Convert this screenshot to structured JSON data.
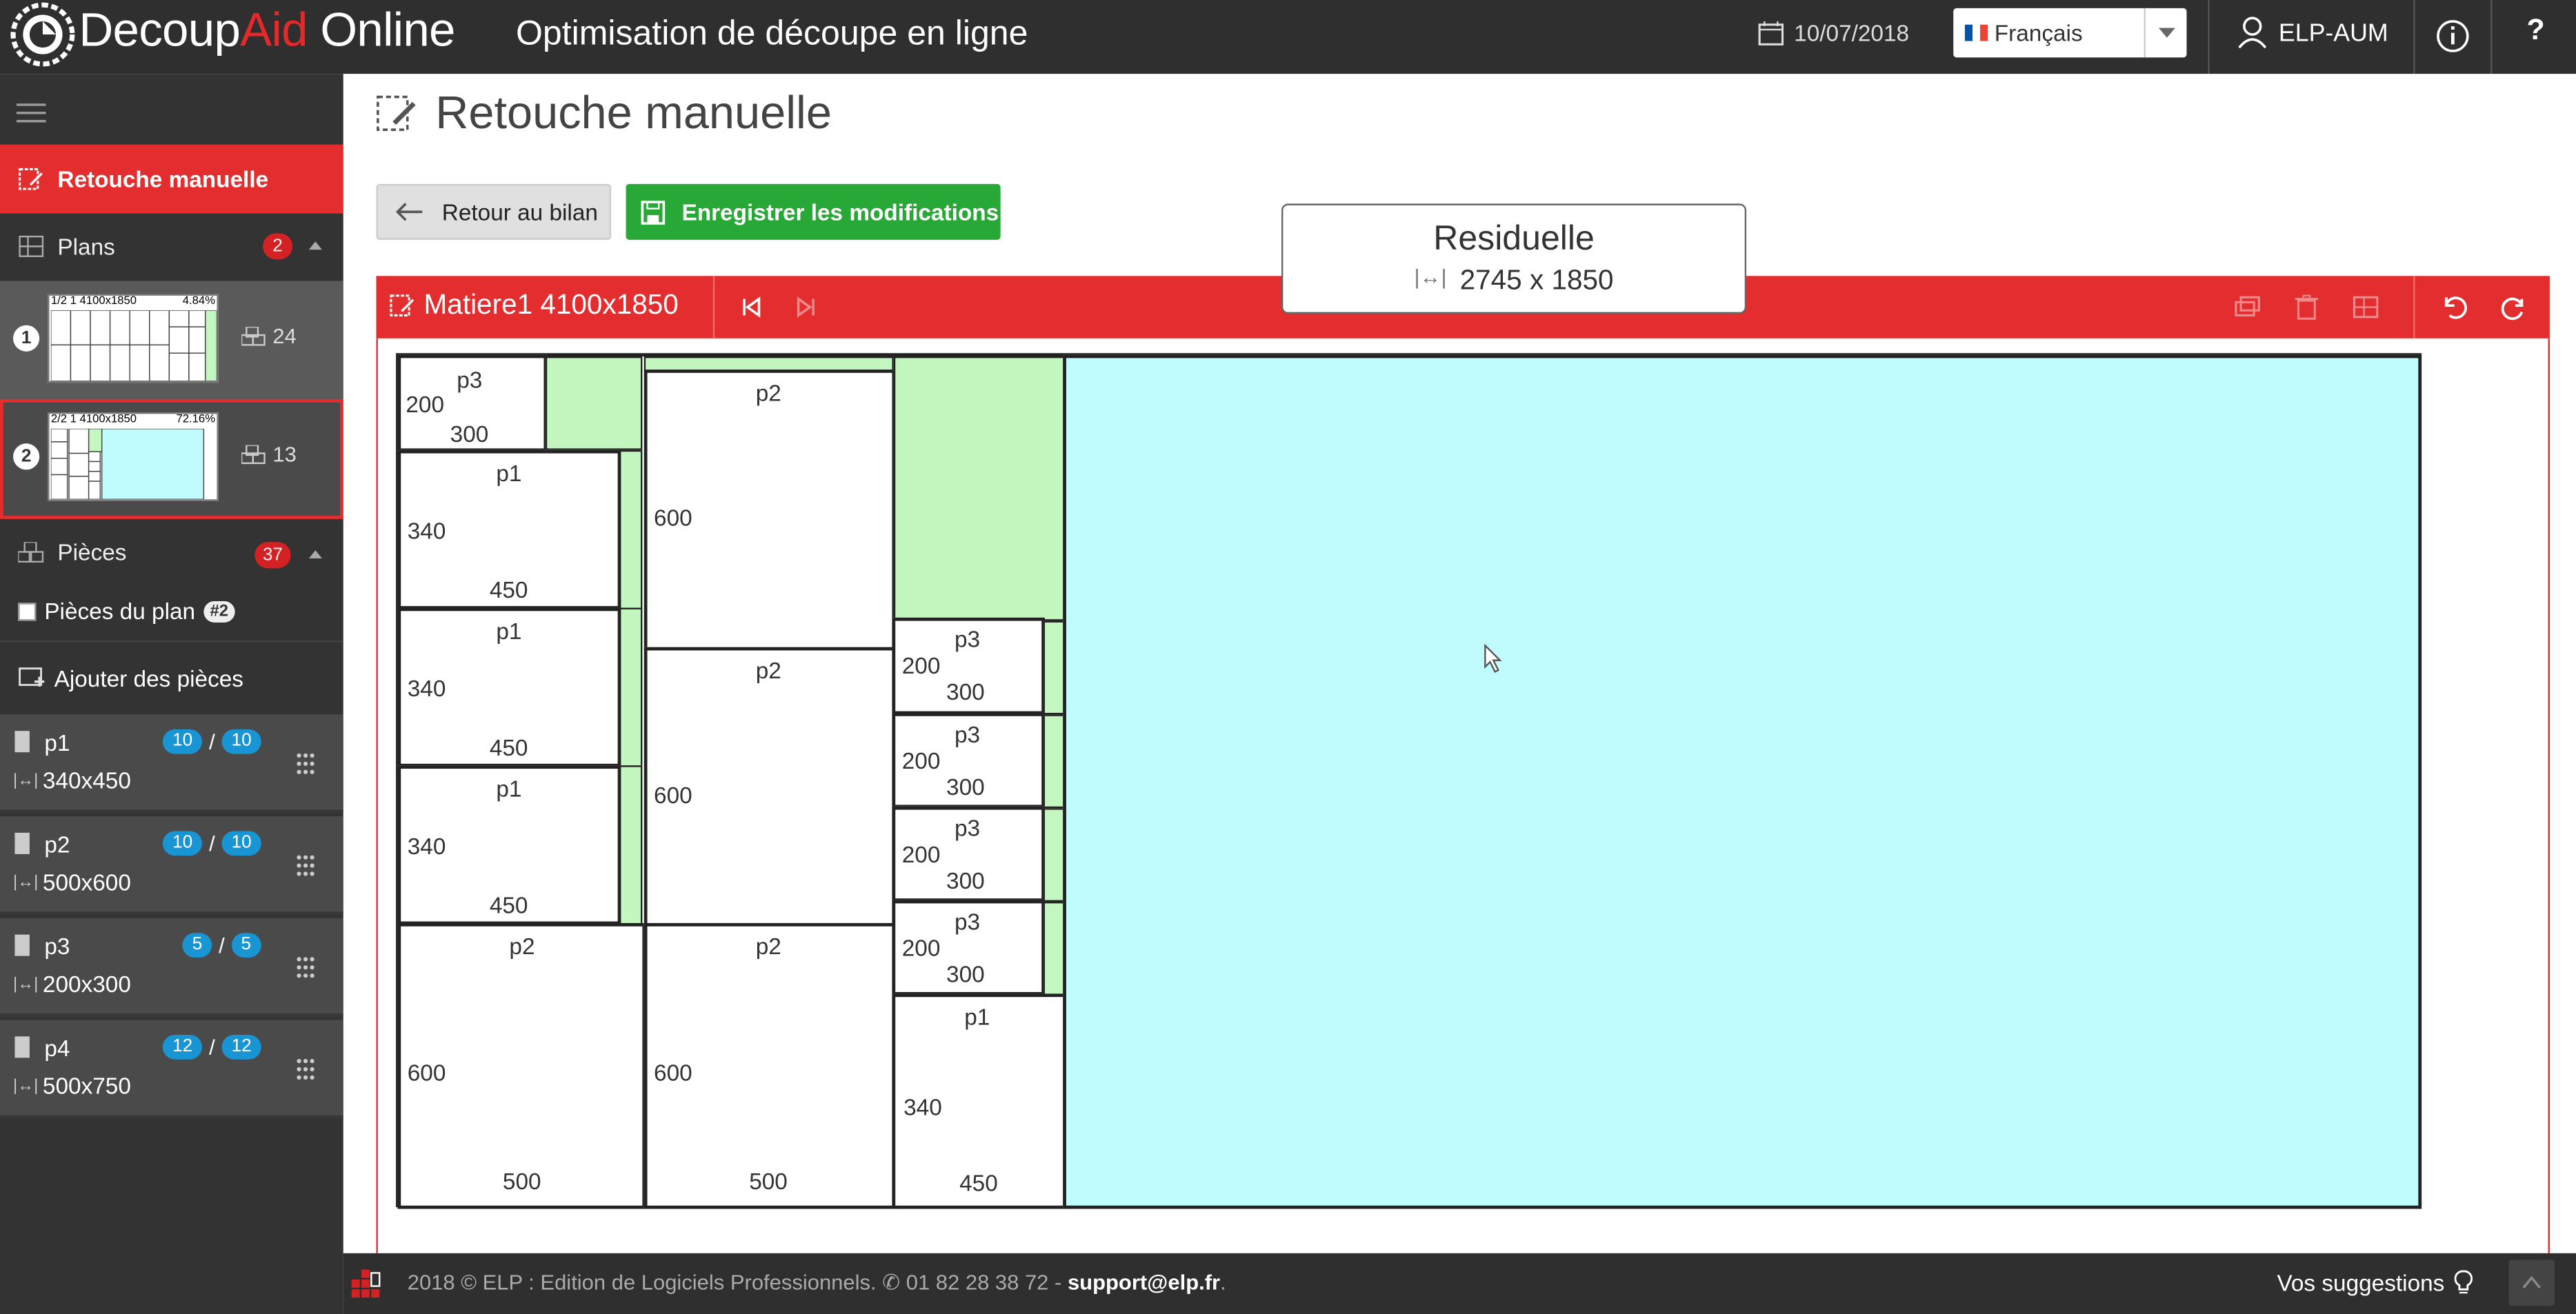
{
  "header": {
    "brand_part1": "Decoup",
    "brand_part2": "Aid",
    "brand_part3": " Online",
    "app_title": "Optimisation de découpe en ligne",
    "date": "10/07/2018",
    "language": "Français",
    "user": "ELP-AUM",
    "help": "?"
  },
  "sidebar": {
    "active_item": "Retouche manuelle",
    "plans_label": "Plans",
    "plans_count": "2",
    "plans": [
      {
        "num": "1",
        "thumb_label": "1/2  1 4100x1850",
        "thumb_pct": "4.84%",
        "count": "24"
      },
      {
        "num": "2",
        "thumb_label": "2/2  1 4100x1850",
        "thumb_pct": "72.16%",
        "count": "13"
      }
    ],
    "pieces_label": "Pièces",
    "pieces_count": "37",
    "plan_pieces_label": "Pièces du plan",
    "plan_pieces_badge": "#2",
    "add_pieces_label": "Ajouter des pièces",
    "pieces": [
      {
        "name": "p1",
        "placed": "10",
        "total": "10",
        "dims": "340x450"
      },
      {
        "name": "p2",
        "placed": "10",
        "total": "10",
        "dims": "500x600"
      },
      {
        "name": "p3",
        "placed": "5",
        "total": "5",
        "dims": "200x300"
      },
      {
        "name": "p4",
        "placed": "12",
        "total": "12",
        "dims": "500x750"
      }
    ],
    "slash": "/"
  },
  "main": {
    "page_title": "Retouche manuelle",
    "back_button": "Retour au bilan",
    "save_button": "Enregistrer les modifications",
    "material_title": "Matiere1 4100x1850",
    "residual_popup": {
      "title": "Residuelle",
      "dims": "2745 x 1850"
    }
  },
  "cutting_plan": {
    "pieces": [
      {
        "name": "p3",
        "w": "300",
        "h": "200"
      },
      {
        "name": "p1",
        "w": "450",
        "h": "340"
      },
      {
        "name": "p1",
        "w": "450",
        "h": "340"
      },
      {
        "name": "p1",
        "w": "450",
        "h": "340"
      },
      {
        "name": "p2",
        "w": "500",
        "h": "600"
      },
      {
        "name": "p2",
        "w": "",
        "h": "600"
      },
      {
        "name": "p2",
        "w": "",
        "h": "600"
      },
      {
        "name": "p2",
        "w": "500",
        "h": "600"
      },
      {
        "name": "p3",
        "w": "300",
        "h": "200"
      },
      {
        "name": "p3",
        "w": "300",
        "h": "200"
      },
      {
        "name": "p3",
        "w": "300",
        "h": "200"
      },
      {
        "name": "p3",
        "w": "300",
        "h": "200"
      },
      {
        "name": "p1",
        "w": "340",
        "h": "450"
      }
    ]
  },
  "footer": {
    "copyright": "2018 © ELP : Edition de Logiciels Professionnels. ",
    "phone": "01 82 28 38 72 - ",
    "email": "support@elp.fr",
    "period": ".",
    "suggestions": "Vos suggestions"
  }
}
